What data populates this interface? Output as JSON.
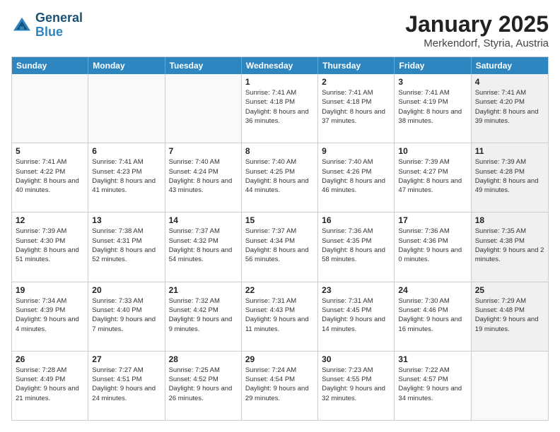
{
  "header": {
    "logo_line1": "General",
    "logo_line2": "Blue",
    "title": "January 2025",
    "subtitle": "Merkendorf, Styria, Austria"
  },
  "days_of_week": [
    "Sunday",
    "Monday",
    "Tuesday",
    "Wednesday",
    "Thursday",
    "Friday",
    "Saturday"
  ],
  "weeks": [
    [
      {
        "day": "",
        "info": "",
        "empty": true
      },
      {
        "day": "",
        "info": "",
        "empty": true
      },
      {
        "day": "",
        "info": "",
        "empty": true
      },
      {
        "day": "1",
        "info": "Sunrise: 7:41 AM\nSunset: 4:18 PM\nDaylight: 8 hours and 36 minutes.",
        "empty": false
      },
      {
        "day": "2",
        "info": "Sunrise: 7:41 AM\nSunset: 4:18 PM\nDaylight: 8 hours and 37 minutes.",
        "empty": false
      },
      {
        "day": "3",
        "info": "Sunrise: 7:41 AM\nSunset: 4:19 PM\nDaylight: 8 hours and 38 minutes.",
        "empty": false
      },
      {
        "day": "4",
        "info": "Sunrise: 7:41 AM\nSunset: 4:20 PM\nDaylight: 8 hours and 39 minutes.",
        "empty": false,
        "shaded": true
      }
    ],
    [
      {
        "day": "5",
        "info": "Sunrise: 7:41 AM\nSunset: 4:22 PM\nDaylight: 8 hours and 40 minutes.",
        "empty": false
      },
      {
        "day": "6",
        "info": "Sunrise: 7:41 AM\nSunset: 4:23 PM\nDaylight: 8 hours and 41 minutes.",
        "empty": false
      },
      {
        "day": "7",
        "info": "Sunrise: 7:40 AM\nSunset: 4:24 PM\nDaylight: 8 hours and 43 minutes.",
        "empty": false
      },
      {
        "day": "8",
        "info": "Sunrise: 7:40 AM\nSunset: 4:25 PM\nDaylight: 8 hours and 44 minutes.",
        "empty": false
      },
      {
        "day": "9",
        "info": "Sunrise: 7:40 AM\nSunset: 4:26 PM\nDaylight: 8 hours and 46 minutes.",
        "empty": false
      },
      {
        "day": "10",
        "info": "Sunrise: 7:39 AM\nSunset: 4:27 PM\nDaylight: 8 hours and 47 minutes.",
        "empty": false
      },
      {
        "day": "11",
        "info": "Sunrise: 7:39 AM\nSunset: 4:28 PM\nDaylight: 8 hours and 49 minutes.",
        "empty": false,
        "shaded": true
      }
    ],
    [
      {
        "day": "12",
        "info": "Sunrise: 7:39 AM\nSunset: 4:30 PM\nDaylight: 8 hours and 51 minutes.",
        "empty": false
      },
      {
        "day": "13",
        "info": "Sunrise: 7:38 AM\nSunset: 4:31 PM\nDaylight: 8 hours and 52 minutes.",
        "empty": false
      },
      {
        "day": "14",
        "info": "Sunrise: 7:37 AM\nSunset: 4:32 PM\nDaylight: 8 hours and 54 minutes.",
        "empty": false
      },
      {
        "day": "15",
        "info": "Sunrise: 7:37 AM\nSunset: 4:34 PM\nDaylight: 8 hours and 56 minutes.",
        "empty": false
      },
      {
        "day": "16",
        "info": "Sunrise: 7:36 AM\nSunset: 4:35 PM\nDaylight: 8 hours and 58 minutes.",
        "empty": false
      },
      {
        "day": "17",
        "info": "Sunrise: 7:36 AM\nSunset: 4:36 PM\nDaylight: 9 hours and 0 minutes.",
        "empty": false
      },
      {
        "day": "18",
        "info": "Sunrise: 7:35 AM\nSunset: 4:38 PM\nDaylight: 9 hours and 2 minutes.",
        "empty": false,
        "shaded": true
      }
    ],
    [
      {
        "day": "19",
        "info": "Sunrise: 7:34 AM\nSunset: 4:39 PM\nDaylight: 9 hours and 4 minutes.",
        "empty": false
      },
      {
        "day": "20",
        "info": "Sunrise: 7:33 AM\nSunset: 4:40 PM\nDaylight: 9 hours and 7 minutes.",
        "empty": false
      },
      {
        "day": "21",
        "info": "Sunrise: 7:32 AM\nSunset: 4:42 PM\nDaylight: 9 hours and 9 minutes.",
        "empty": false
      },
      {
        "day": "22",
        "info": "Sunrise: 7:31 AM\nSunset: 4:43 PM\nDaylight: 9 hours and 11 minutes.",
        "empty": false
      },
      {
        "day": "23",
        "info": "Sunrise: 7:31 AM\nSunset: 4:45 PM\nDaylight: 9 hours and 14 minutes.",
        "empty": false
      },
      {
        "day": "24",
        "info": "Sunrise: 7:30 AM\nSunset: 4:46 PM\nDaylight: 9 hours and 16 minutes.",
        "empty": false
      },
      {
        "day": "25",
        "info": "Sunrise: 7:29 AM\nSunset: 4:48 PM\nDaylight: 9 hours and 19 minutes.",
        "empty": false,
        "shaded": true
      }
    ],
    [
      {
        "day": "26",
        "info": "Sunrise: 7:28 AM\nSunset: 4:49 PM\nDaylight: 9 hours and 21 minutes.",
        "empty": false
      },
      {
        "day": "27",
        "info": "Sunrise: 7:27 AM\nSunset: 4:51 PM\nDaylight: 9 hours and 24 minutes.",
        "empty": false
      },
      {
        "day": "28",
        "info": "Sunrise: 7:25 AM\nSunset: 4:52 PM\nDaylight: 9 hours and 26 minutes.",
        "empty": false
      },
      {
        "day": "29",
        "info": "Sunrise: 7:24 AM\nSunset: 4:54 PM\nDaylight: 9 hours and 29 minutes.",
        "empty": false
      },
      {
        "day": "30",
        "info": "Sunrise: 7:23 AM\nSunset: 4:55 PM\nDaylight: 9 hours and 32 minutes.",
        "empty": false
      },
      {
        "day": "31",
        "info": "Sunrise: 7:22 AM\nSunset: 4:57 PM\nDaylight: 9 hours and 34 minutes.",
        "empty": false
      },
      {
        "day": "",
        "info": "",
        "empty": true,
        "shaded": true
      }
    ]
  ]
}
